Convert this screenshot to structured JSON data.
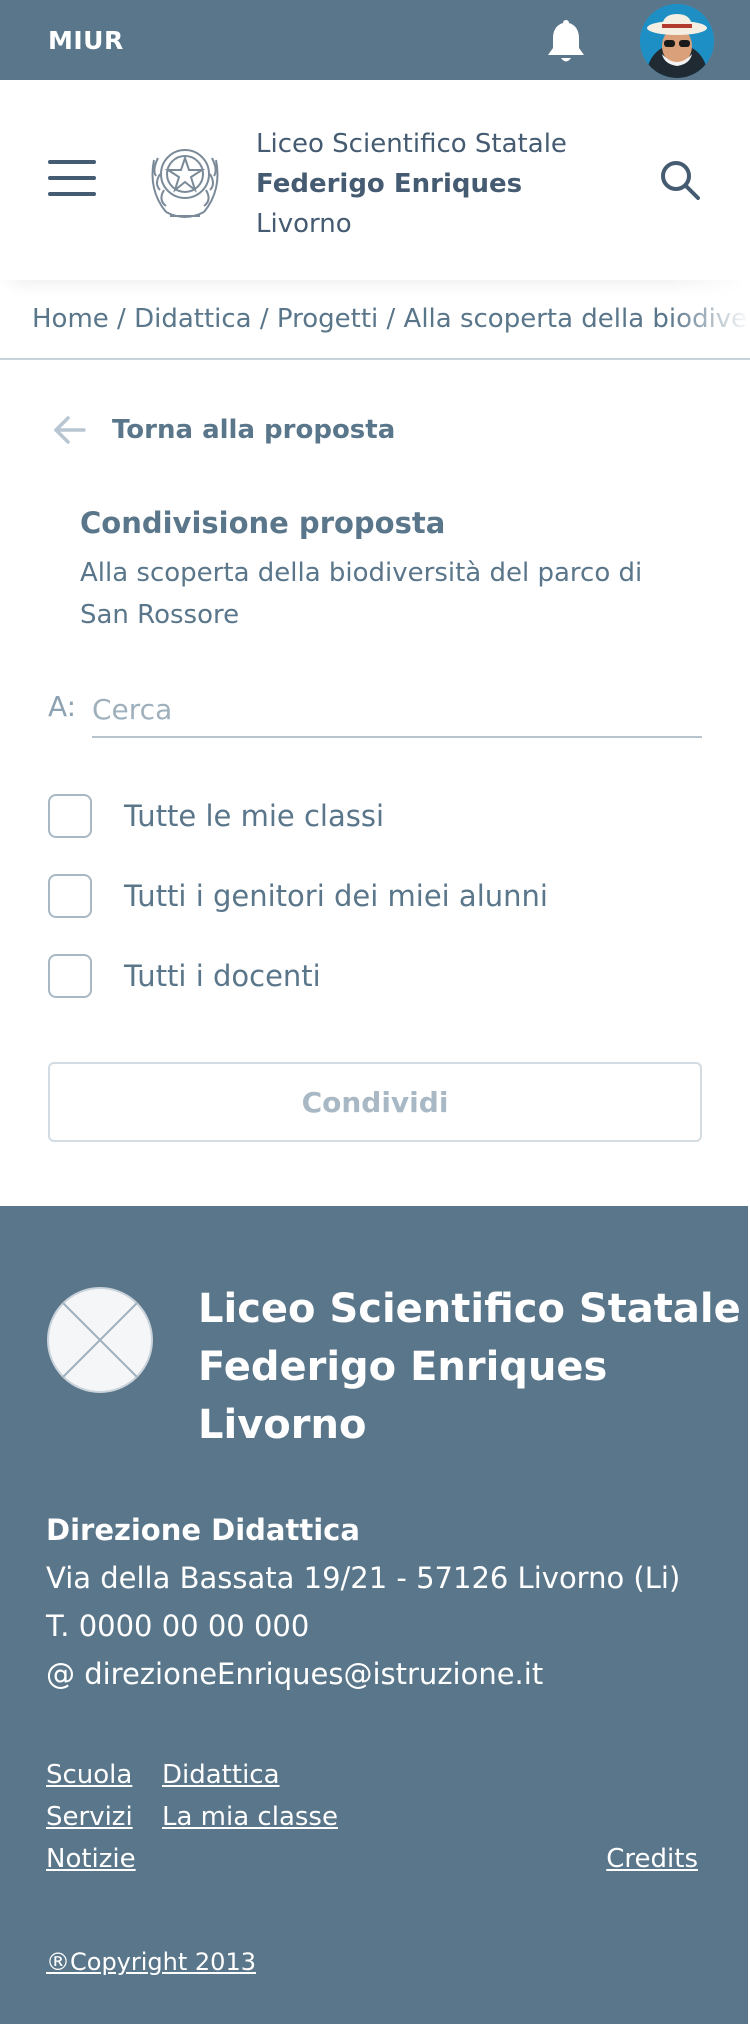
{
  "topbar": {
    "brand": "MIUR",
    "bell_icon": "bell-icon",
    "avatar": "user-avatar"
  },
  "header": {
    "menu_icon": "hamburger-icon",
    "emblem": "italian-republic-emblem",
    "school_line1": "Liceo Scientifico Statale",
    "school_line2": "Federigo Enriques",
    "school_line3": "Livorno",
    "search_icon": "search-icon"
  },
  "breadcrumb": {
    "trail": "Home / Didattica / Progetti / Alla scoperta della biodiversità del parco di San Rossore"
  },
  "back": {
    "label": "Torna alla proposta"
  },
  "share": {
    "title": "Condivisione proposta",
    "subtitle": "Alla scoperta della biodiversità del parco di San Rossore",
    "to_label": "A:",
    "to_placeholder": "Cerca",
    "to_value": "",
    "options": [
      {
        "label": "Tutte le mie classi",
        "checked": false
      },
      {
        "label": "Tutti i genitori dei miei alunni",
        "checked": false
      },
      {
        "label": "Tutti i docenti",
        "checked": false
      }
    ],
    "button_label": "Condividi"
  },
  "footer": {
    "school_line1": "Liceo Scientifico Statale",
    "school_line2": "Federigo Enriques",
    "school_line3": "Livorno",
    "address_head": "Direzione Didattica",
    "address": "Via della Bassata 19/21 - 57126 Livorno (Li)",
    "phone": "T. 0000 00 00 000",
    "email": "@ direzioneEnriques@istruzione.it",
    "links": {
      "scuola": "Scuola",
      "didattica": "Didattica",
      "servizi": "Servizi",
      "la_mia_classe": "La mia classe",
      "notizie": "Notizie",
      "credits": "Credits"
    },
    "copyright": "®Copyright 2013"
  },
  "colors": {
    "primary": "#5a768a",
    "text": "#455b71",
    "muted": "#a8b8c4"
  }
}
